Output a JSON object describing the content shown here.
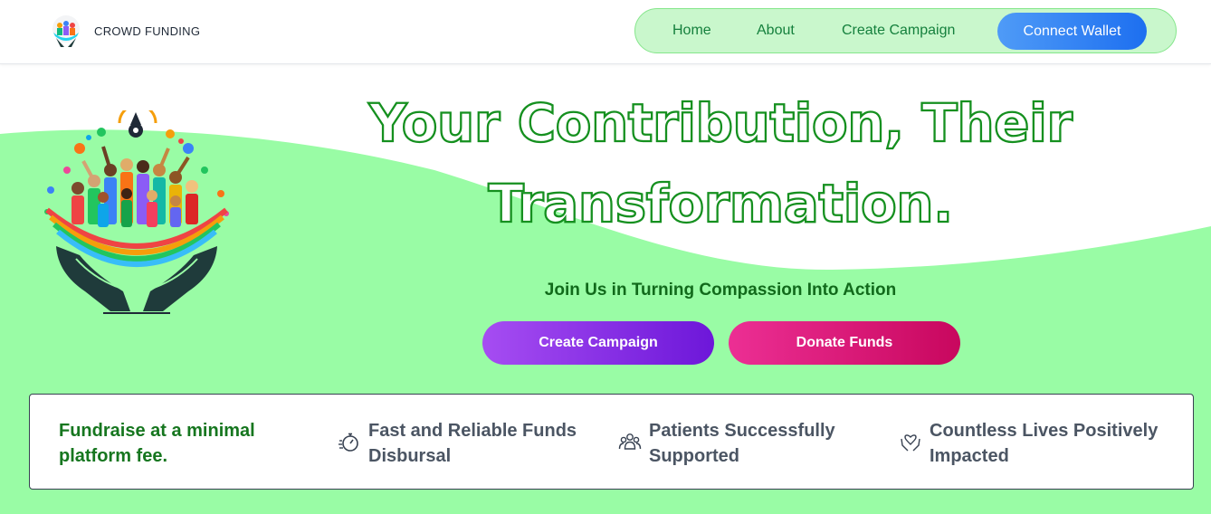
{
  "header": {
    "brand_name": "CROWD FUNDING",
    "nav": {
      "home": "Home",
      "about": "About",
      "create_campaign": "Create Campaign",
      "connect_wallet": "Connect Wallet"
    }
  },
  "hero": {
    "headline_line1": "Your Contribution, Their",
    "headline_line2": "Transformation.",
    "tagline": "Join Us in Turning Compassion Into Action",
    "create_campaign_button": "Create Campaign",
    "donate_funds_button": "Donate Funds"
  },
  "features": {
    "fee_text": "Fundraise at a minimal platform fee.",
    "items": [
      {
        "icon": "stopwatch-icon",
        "text": "Fast and Reliable Funds Disbursal"
      },
      {
        "icon": "people-group-icon",
        "text": "Patients Successfully Supported"
      },
      {
        "icon": "heart-hands-icon",
        "text": "Countless Lives Positively Impacted"
      }
    ]
  },
  "colors": {
    "brand_green": "#15803d",
    "hero_background": "#99fca5",
    "nav_pill": "#c9f7cc",
    "wallet_button": "#2b7ef3",
    "create_button": "#8a2be2",
    "donate_button": "#e0187a"
  }
}
